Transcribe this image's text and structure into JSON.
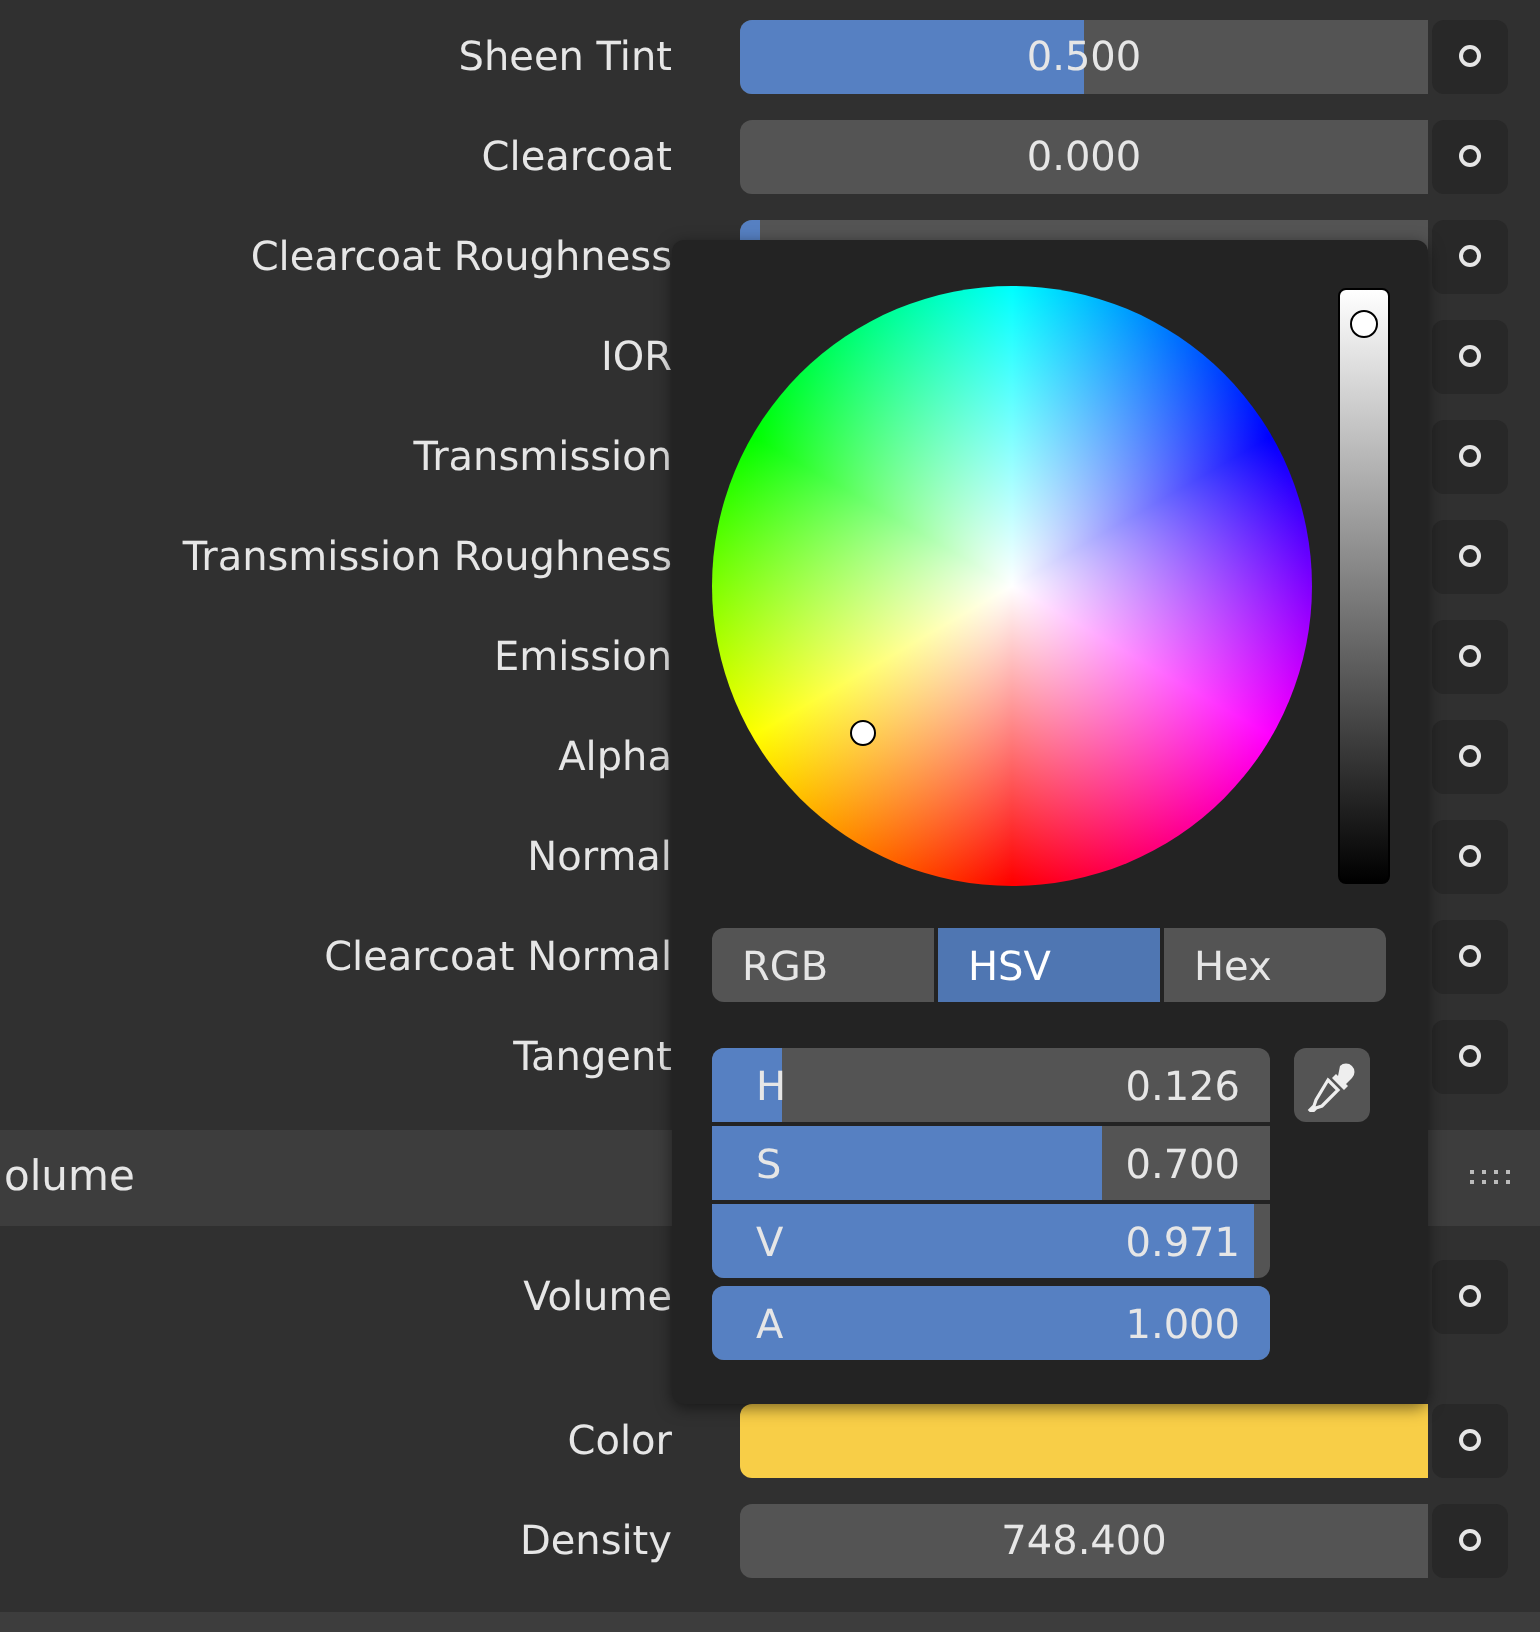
{
  "rows": [
    {
      "label": "Sheen Tint",
      "kind": "slider",
      "level": 0.5,
      "value": "0.500"
    },
    {
      "label": "Clearcoat",
      "kind": "slider",
      "level": 0,
      "value": "0.000"
    },
    {
      "label": "Clearcoat Roughness",
      "kind": "slider",
      "level": 0.03
    },
    {
      "label": "IOR",
      "kind": "covered"
    },
    {
      "label": "Transmission",
      "kind": "covered"
    },
    {
      "label": "Transmission Roughness",
      "kind": "covered"
    },
    {
      "label": "Emission",
      "kind": "covered"
    },
    {
      "label": "Alpha",
      "kind": "covered"
    },
    {
      "label": "Normal",
      "kind": "covered"
    },
    {
      "label": "Clearcoat Normal",
      "kind": "covered"
    },
    {
      "label": "Tangent",
      "kind": "covered"
    }
  ],
  "section": {
    "title": "olume"
  },
  "volume_rows": [
    {
      "label": "Volume",
      "kind": "covered"
    },
    {
      "label": "Color",
      "kind": "color",
      "color": "#f8ce47"
    },
    {
      "label": "Density",
      "kind": "number",
      "value": "748.400"
    }
  ],
  "color_picker": {
    "modes": [
      {
        "label": "RGB",
        "selected": false
      },
      {
        "label": "HSV",
        "selected": true
      },
      {
        "label": "Hex",
        "selected": false
      }
    ],
    "channels": [
      {
        "label": "H",
        "value": "0.126",
        "level": 0.126
      },
      {
        "label": "S",
        "value": "0.700",
        "level": 0.7
      },
      {
        "label": "V",
        "value": "0.971",
        "level": 0.971
      },
      {
        "label": "A",
        "value": "1.000",
        "level": 1
      }
    ]
  }
}
